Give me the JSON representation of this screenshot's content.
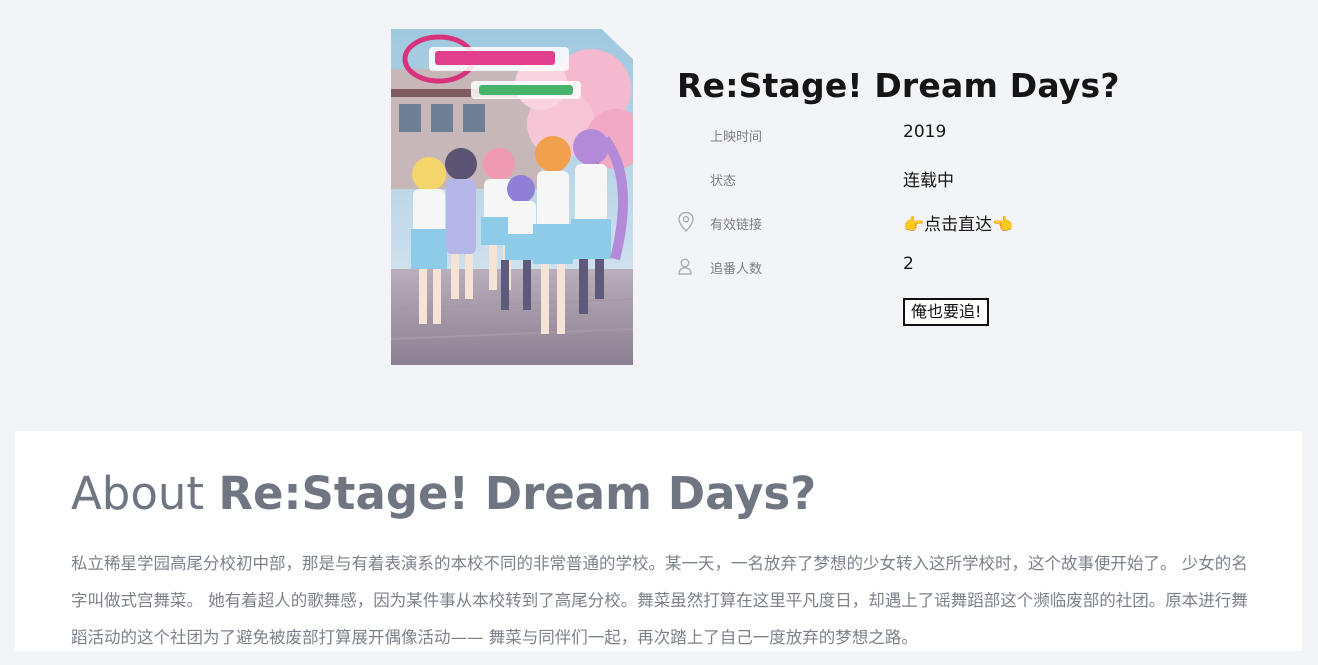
{
  "colors": {
    "page_background": "#f3f4f7",
    "card_background": "#ffffff",
    "heading_gray": "#6f7682",
    "label_gray": "#7b8089",
    "poster_pink": "#f7c6d6",
    "poster_blue": "#8ecbe8"
  },
  "anime": {
    "title": "Re:Stage! Dream Days?",
    "poster_icon": "anime-poster-image"
  },
  "info": {
    "release": {
      "icon": "",
      "label": "上映时间",
      "value": "2019"
    },
    "status": {
      "icon": "",
      "label": "状态",
      "value": "连载中"
    },
    "link": {
      "icon": "location-pin-icon",
      "label": "有效链接",
      "value": "👉点击直达👈"
    },
    "followers": {
      "icon": "user-icon",
      "label": "追番人数",
      "value": "2"
    }
  },
  "follow_button": {
    "label": "俺也要追!"
  },
  "about": {
    "heading_prefix": "About ",
    "heading_title": "Re:Stage! Dream Days?",
    "description": "私立稀星学园高尾分校初中部，那是与有着表演系的本校不同的非常普通的学校。某一天，一名放弃了梦想的少女转入这所学校时，这个故事便开始了。 少女的名字叫做式宫舞菜。 她有着超人的歌舞感，因为某件事从本校转到了高尾分校。舞菜虽然打算在这里平凡度日，却遇上了谣舞蹈部这个濒临废部的社团。原本进行舞蹈活动的这个社团为了避免被废部打算展开偶像活动—— 舞菜与同伴们一起，再次踏上了自己一度放弃的梦想之路。"
  }
}
